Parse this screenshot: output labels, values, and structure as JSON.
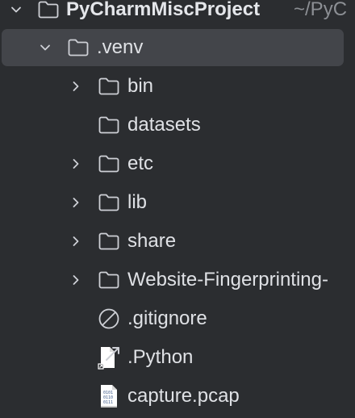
{
  "project_tree": {
    "root": {
      "label": "PyCharmMiscProject",
      "path_hint": "~/PyC",
      "icon": "folder-icon",
      "expanded": true
    },
    "venv": {
      "label": ".venv",
      "icon": "folder-icon",
      "expanded": true,
      "selected": true
    },
    "items": [
      {
        "label": "bin",
        "icon": "folder-icon",
        "has_children": true
      },
      {
        "label": "datasets",
        "icon": "folder-icon",
        "has_children": false
      },
      {
        "label": "etc",
        "icon": "folder-icon",
        "has_children": true
      },
      {
        "label": "lib",
        "icon": "folder-icon",
        "has_children": true
      },
      {
        "label": "share",
        "icon": "folder-icon",
        "has_children": true
      },
      {
        "label": "Website-Fingerprinting-",
        "icon": "folder-icon",
        "has_children": true
      },
      {
        "label": ".gitignore",
        "icon": "ignore-file-icon",
        "has_children": false
      },
      {
        "label": ".Python",
        "icon": "symlink-file-icon",
        "has_children": false
      },
      {
        "label": "capture.pcap",
        "icon": "binary-file-icon",
        "has_children": false
      }
    ]
  },
  "colors": {
    "background": "#2b2d30",
    "selection": "#43454a",
    "text": "#dfe1e5",
    "muted": "#8c8f94",
    "icon_stroke": "#ced0d6"
  }
}
